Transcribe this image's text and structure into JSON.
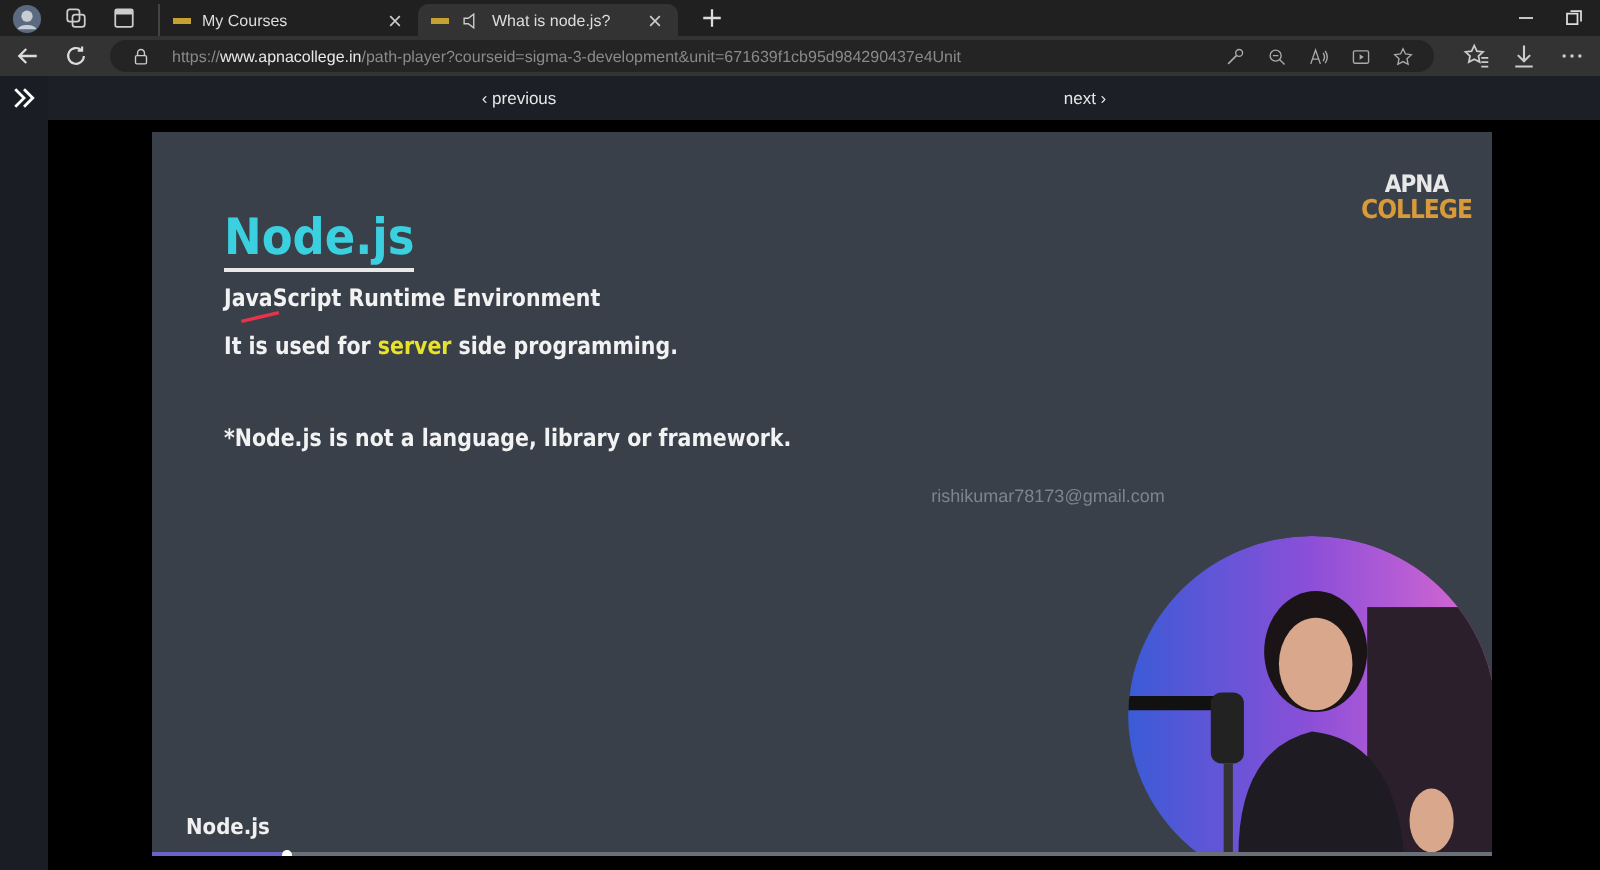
{
  "browser": {
    "tabs": [
      {
        "title": "My Courses",
        "selected": false,
        "audio": false
      },
      {
        "title": "What is node.js?",
        "selected": true,
        "audio": true
      }
    ],
    "url": {
      "scheme": "https://",
      "host": "www.apnacollege.in",
      "path": "/path-player?courseid=sigma-3-development&unit=671639f1cb95d984290437e4Unit"
    }
  },
  "player": {
    "previous": "‹ previous",
    "next": "next ›",
    "slide": {
      "title": "Node.js",
      "lines": [
        {
          "kind": "plain",
          "parts": [
            {
              "text": "JavaScript Runtime Environment",
              "highlight": false
            }
          ]
        },
        {
          "kind": "plain",
          "parts": [
            {
              "text": "It is used for ",
              "highlight": false
            },
            {
              "text": "server",
              "highlight": true
            },
            {
              "text": " side programming.",
              "highlight": false
            }
          ]
        },
        {
          "kind": "note",
          "parts": [
            {
              "text": "*Node.js is not a language, library or framework.",
              "highlight": false
            }
          ]
        }
      ],
      "logo": [
        "APNA",
        "COLLEGE"
      ],
      "watermark": "rishikumar78173@gmail.com"
    },
    "caption": "Node.js",
    "progress": {
      "level": 0.1
    }
  }
}
